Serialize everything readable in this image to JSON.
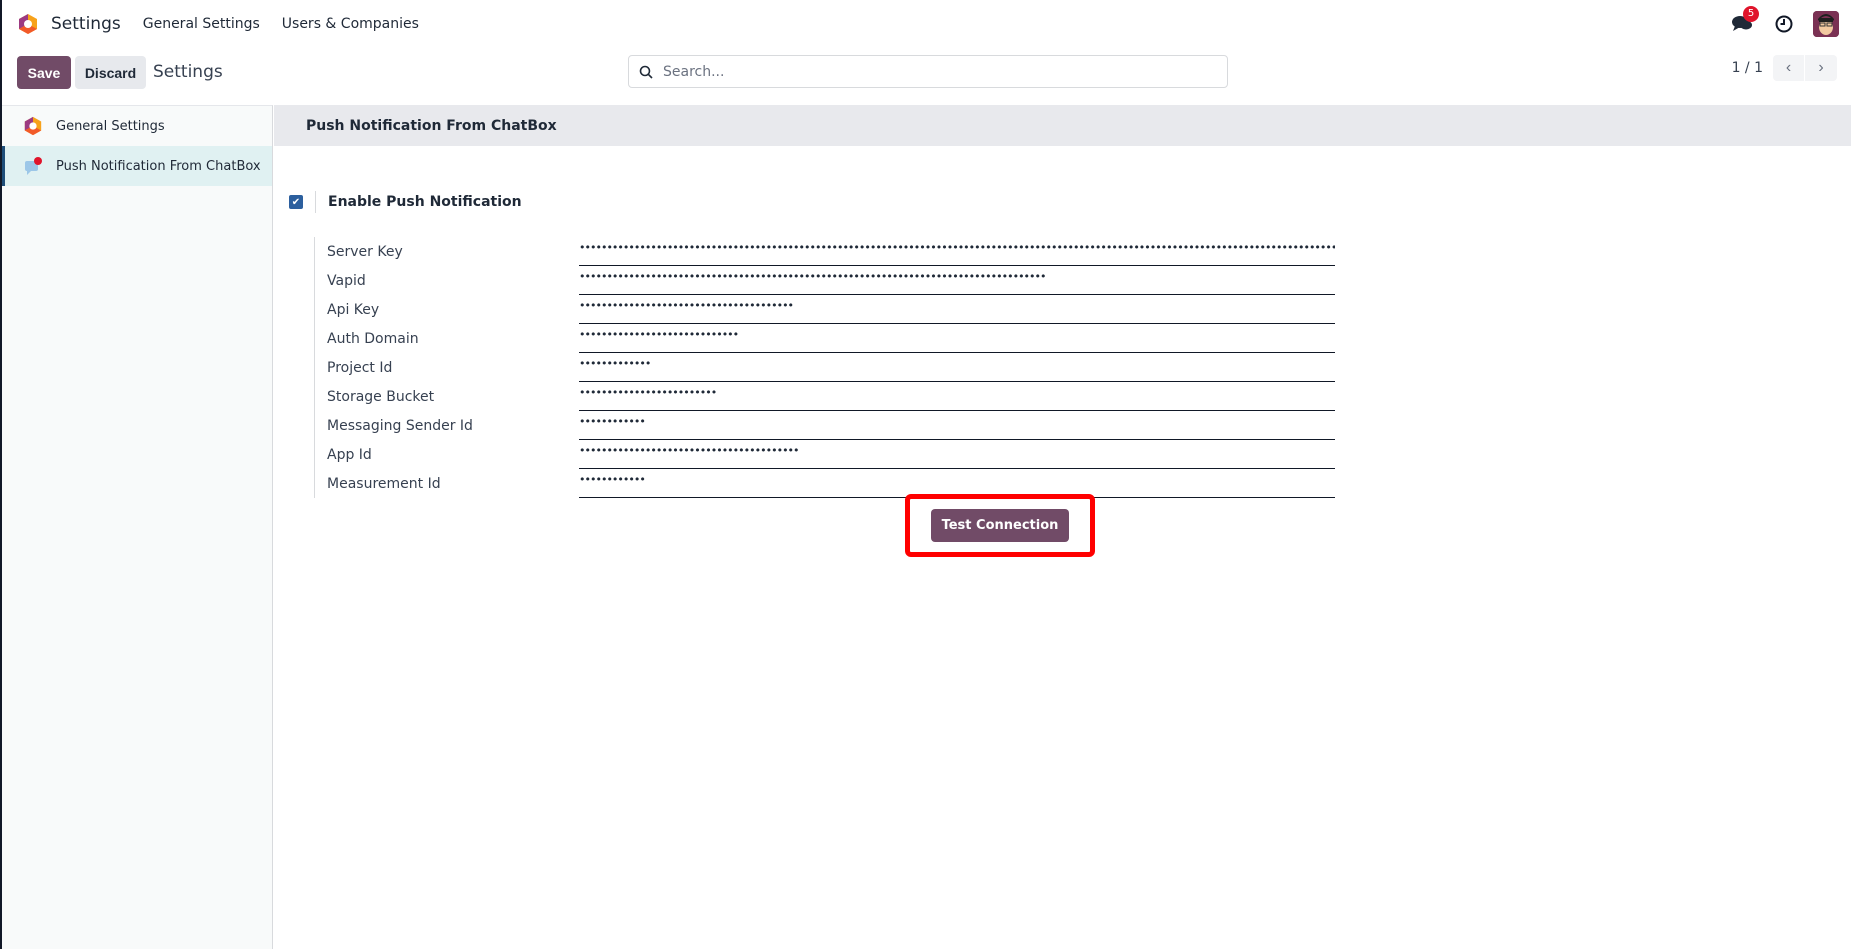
{
  "topbar": {
    "app_name": "Settings",
    "menu": [
      "General Settings",
      "Users & Companies"
    ],
    "chat_badge": "5"
  },
  "controlbar": {
    "save_label": "Save",
    "discard_label": "Discard",
    "title": "Settings",
    "search_placeholder": "Search...",
    "pager": "1 / 1"
  },
  "sidebar": {
    "items": [
      {
        "label": "General Settings",
        "icon": "odoo-logo-icon",
        "active": false
      },
      {
        "label": "Push Notification From ChatBox",
        "icon": "chat-notification-icon",
        "active": true
      }
    ]
  },
  "main": {
    "section_title": "Push Notification From ChatBox",
    "enable_label": "Enable Push Notification",
    "enable_checked": true,
    "fields": [
      {
        "label": "Server Key",
        "value": "••••••••••••••••••••••••••••••••••••••••••••••••••••••••••••••••••••••••••••••••••••••••••••••••••••••••••••••••••••••••••••••••••••••••••"
      },
      {
        "label": "Vapid",
        "value": "•••••••••••••••••••••••••••••••••••••••••••••••••••••••••••••••••••••••••••••••••••••"
      },
      {
        "label": "Api Key",
        "value": "•••••••••••••••••••••••••••••••••••••••"
      },
      {
        "label": "Auth Domain",
        "value": "•••••••••••••••••••••••••••••"
      },
      {
        "label": "Project Id",
        "value": "•••••••••••••"
      },
      {
        "label": "Storage Bucket",
        "value": "•••••••••••••••••••••••••"
      },
      {
        "label": "Messaging Sender Id",
        "value": "••••••••••••"
      },
      {
        "label": "App Id",
        "value": "••••••••••••••••••••••••••••••••••••••••"
      },
      {
        "label": "Measurement Id",
        "value": "••••••••••••"
      }
    ],
    "test_button_label": "Test Connection",
    "highlight_color": "#ff0000",
    "brand_color": "#714B67"
  }
}
